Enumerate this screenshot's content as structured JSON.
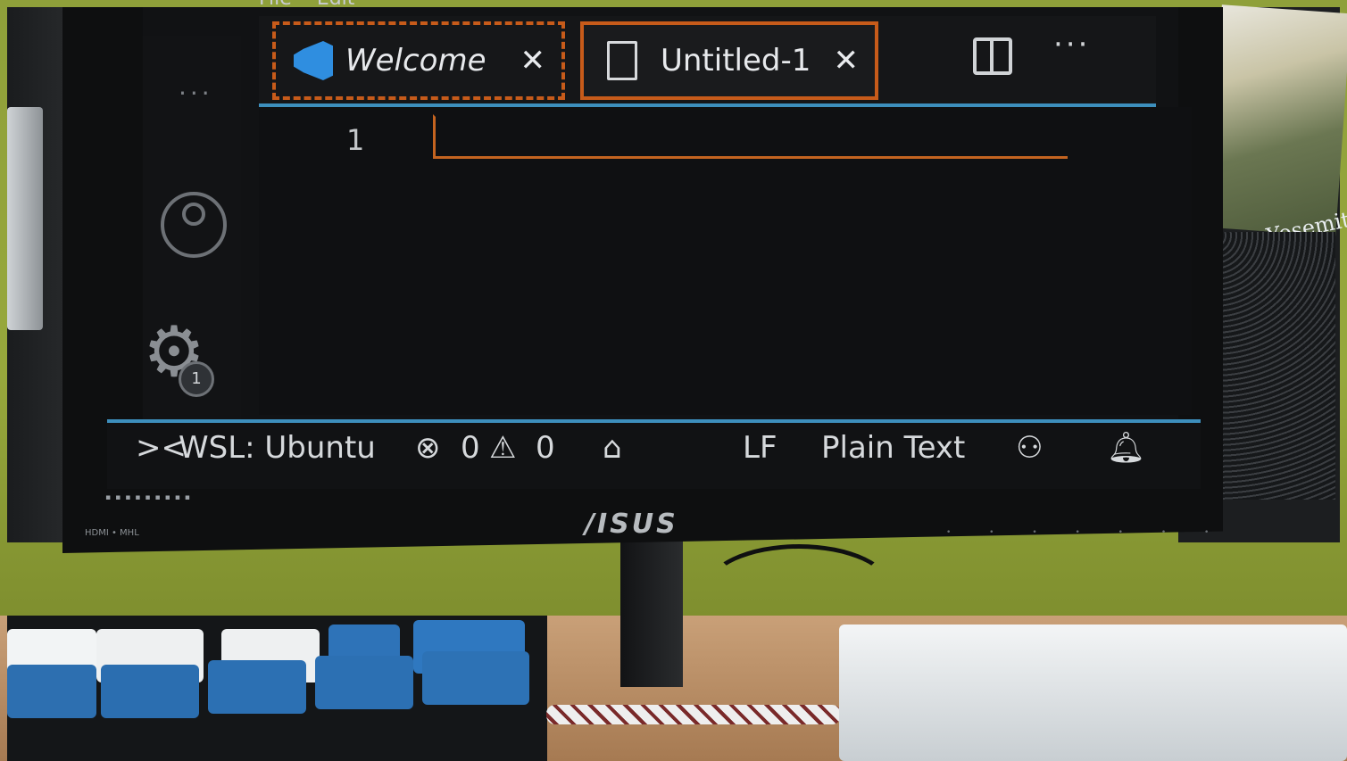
{
  "menubar": {
    "items": [
      "File",
      "Edit"
    ]
  },
  "activity": {
    "more_label": "...",
    "settings_badge": "1"
  },
  "tabs": [
    {
      "label": "Welcome",
      "close": "✕"
    },
    {
      "label": "Untitled-1",
      "close": "✕"
    }
  ],
  "editor_actions": {
    "more_label": "···"
  },
  "editor": {
    "line_numbers": [
      "1"
    ]
  },
  "status": {
    "remote_icon": "><",
    "remote_label": "WSL: Ubuntu",
    "errors": "0",
    "warnings": "0",
    "eol": "LF",
    "language": "Plain Text"
  },
  "monitor": {
    "brand": "/ISUS",
    "ports": "HDMI • MHL"
  },
  "poster": {
    "text": "Yosemite"
  },
  "colors": {
    "accent_orange": "#c75b1a",
    "statusbar_border": "#3d8fbd",
    "vscode_blue": "#2f8ee0"
  }
}
